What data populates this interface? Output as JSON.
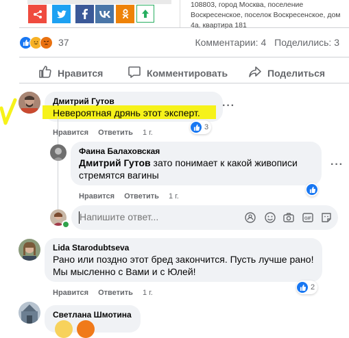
{
  "share_bar": {
    "items": [
      {
        "icon": "share-icon",
        "color": "#ef4b3f"
      },
      {
        "icon": "twitter-icon",
        "color": "#1da1f2"
      },
      {
        "icon": "facebook-icon",
        "color": "#3b5998"
      },
      {
        "icon": "vk-icon",
        "color": "#4a76a8"
      },
      {
        "icon": "odnoklassniki-icon",
        "color": "#ee8208"
      },
      {
        "icon": "arrow-up-icon",
        "color": "#27ae60"
      }
    ]
  },
  "address": {
    "line1": "108803, город Москва, поселение",
    "line2": "Воскресенское, поселок Воскресенское, дом",
    "line3": "4а, квартира 181"
  },
  "post": {
    "reactions_count": "37",
    "comments_label": "Комментарии: 4",
    "shares_label": "Поделились: 3",
    "like_label": "Нравится",
    "comment_label": "Комментировать",
    "share_label": "Поделиться"
  },
  "comments": [
    {
      "author": "Дмитрий Гутов",
      "text": "Невероятная дрянь этот эксперт.",
      "like_link": "Нравится",
      "reply_link": "Ответить",
      "time": "1 г.",
      "likes": "3"
    },
    {
      "author": "Фаина Балаховская",
      "mention": "Дмитрий Гутов",
      "text": " зато понимает к какой живописи стремятся вагины",
      "like_link": "Нравится",
      "reply_link": "Ответить",
      "time": "1 г."
    },
    {
      "author": "Lida Starodubtseva",
      "text": "Рано или поздно этот бред закончится. Пусть лучше рано! Мы мысленно с Вами и с Юлей!",
      "like_link": "Нравится",
      "reply_link": "Ответить",
      "time": "1 г.",
      "likes": "2"
    },
    {
      "author": "Светлана Шмотина"
    }
  ],
  "reply_box": {
    "placeholder": "Напишите ответ..."
  },
  "colors": {
    "facebook_blue": "#1877f2",
    "bubble_bg": "#f0f2f5",
    "highlight": "#f6f21a",
    "muted_text": "#65676b"
  }
}
